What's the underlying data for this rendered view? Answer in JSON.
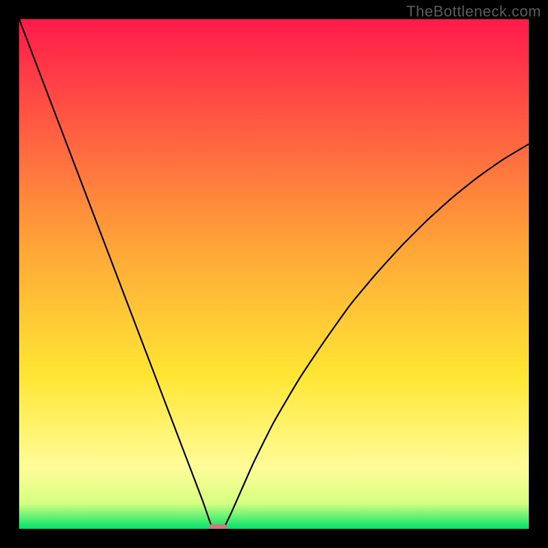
{
  "watermark": "TheBottleneck.com",
  "chart_data": {
    "type": "line",
    "title": "",
    "xlabel": "",
    "ylabel": "",
    "xlim": [
      0,
      100
    ],
    "ylim": [
      0,
      100
    ],
    "grid": false,
    "legend": false,
    "background_gradient": {
      "stops": [
        {
          "offset": 0.0,
          "color": "#ff1a4b"
        },
        {
          "offset": 0.45,
          "color": "#ffa638"
        },
        {
          "offset": 0.7,
          "color": "#ffe634"
        },
        {
          "offset": 0.88,
          "color": "#fffc9a"
        },
        {
          "offset": 0.95,
          "color": "#d6ff80"
        },
        {
          "offset": 1.0,
          "color": "#00e46a"
        }
      ]
    },
    "series": [
      {
        "name": "bottleneck-curve",
        "x": [
          0,
          4,
          8,
          12,
          16,
          20,
          24,
          28,
          32,
          36,
          38,
          40,
          42,
          46,
          50,
          55,
          60,
          65,
          70,
          75,
          80,
          85,
          90,
          95,
          100
        ],
        "y": [
          100,
          89.5,
          79,
          68.5,
          58,
          47.5,
          37,
          26.5,
          16,
          5.5,
          0,
          0,
          4,
          13,
          21,
          29.5,
          37,
          44,
          50,
          55.5,
          60.5,
          65,
          69,
          72.5,
          75.5
        ],
        "color": "#000000",
        "linewidth": 2.2
      }
    ],
    "marker": {
      "name": "optimal-point",
      "x": 39,
      "y": 0,
      "color": "#d17a7a",
      "shape": "rounded-rect",
      "width": 3.5,
      "height": 1.8
    }
  },
  "plot_geometry": {
    "outer_width": 800,
    "outer_height": 800,
    "inner_left": 28,
    "inner_top": 28,
    "inner_width": 744,
    "inner_height": 744
  }
}
